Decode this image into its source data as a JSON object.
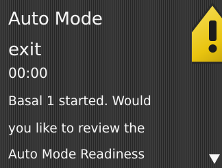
{
  "alert": {
    "title_line1": "Auto Mode",
    "title_line2": "exit",
    "time": "00:00",
    "message_lines": [
      "Basal 1 started. Would",
      "you like to review the",
      "Auto Mode Readiness"
    ]
  },
  "icons": {
    "warning": "warning-triangle-icon",
    "scroll_more": "scroll-down-arrow-icon"
  },
  "colors": {
    "text": "#f6f6f6",
    "warning_fill": "#f2d21a",
    "background": "#3a3a3a"
  }
}
